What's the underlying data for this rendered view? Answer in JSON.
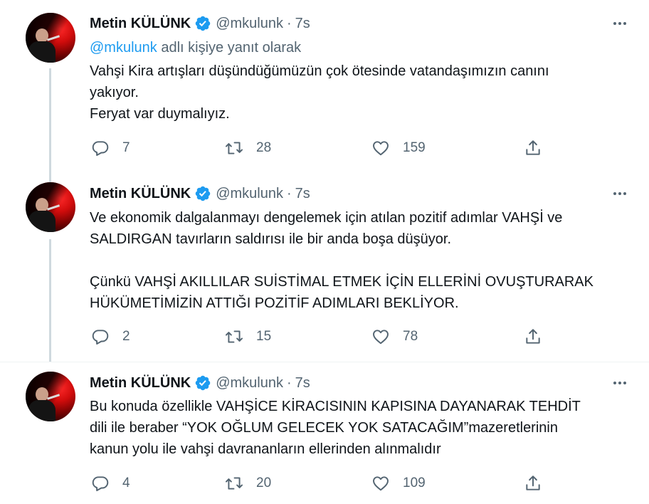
{
  "tweets": [
    {
      "author_name": "Metin KÜLÜNK",
      "handle": "@mkulunk",
      "time": "7s",
      "reply_to": {
        "mention": "@mkulunk",
        "suffix": " adlı kişiye yanıt olarak"
      },
      "lines": [
        "Vahşi Kira artışları düşündüğümüzün çok ötesinde vatandaşımızın canını",
        "yakıyor.",
        "Feryat var duymalıyız."
      ],
      "replies": "7",
      "retweets": "28",
      "likes": "159"
    },
    {
      "author_name": "Metin KÜLÜNK",
      "handle": "@mkulunk",
      "time": "7s",
      "lines": [
        "Ve ekonomik dalgalanmayı dengelemek için atılan pozitif adımlar VAHŞİ ve",
        "SALDIRGAN tavırların saldırısı ile bir anda boşa düşüyor.",
        "",
        "Çünkü VAHŞİ AKILLILAR SUİSTİMAL ETMEK İÇİN ELLERİNİ OVUŞTURARAK",
        "HÜKÜMETİMİZİN ATTIĞI POZİTİF ADIMLARI BEKLİYOR."
      ],
      "replies": "2",
      "retweets": "15",
      "likes": "78"
    },
    {
      "author_name": "Metin KÜLÜNK",
      "handle": "@mkulunk",
      "time": "7s",
      "lines": [
        "Bu konuda özellikle VAHŞİCE KİRACISININ KAPISINA DAYANARAK TEHDİT",
        "dili ile beraber “YOK OĞLUM GELECEK YOK SATACAĞIM”mazeretlerinin",
        "kanun yolu ile vahşi davrananların ellerinden alınmalıdır"
      ],
      "replies": "4",
      "retweets": "20",
      "likes": "109"
    }
  ],
  "header": {
    "separator": "·"
  },
  "icons": {
    "verified": "verified-badge-icon",
    "more": "more-options-icon",
    "reply": "reply-icon",
    "retweet": "retweet-icon",
    "like": "heart-icon",
    "share": "share-icon"
  },
  "colors": {
    "text": "#0f1419",
    "secondary": "#536471",
    "accent": "#1d9bf0",
    "thread_line": "#cfd9de"
  }
}
